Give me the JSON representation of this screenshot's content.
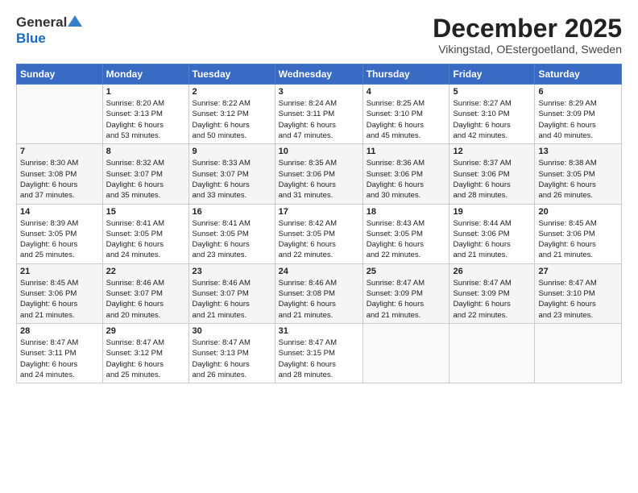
{
  "header": {
    "logo_general": "General",
    "logo_blue": "Blue",
    "month_title": "December 2025",
    "location": "Vikingstad, OEstergoetland, Sweden"
  },
  "columns": [
    "Sunday",
    "Monday",
    "Tuesday",
    "Wednesday",
    "Thursday",
    "Friday",
    "Saturday"
  ],
  "weeks": [
    [
      {
        "day": "",
        "info": ""
      },
      {
        "day": "1",
        "info": "Sunrise: 8:20 AM\nSunset: 3:13 PM\nDaylight: 6 hours\nand 53 minutes."
      },
      {
        "day": "2",
        "info": "Sunrise: 8:22 AM\nSunset: 3:12 PM\nDaylight: 6 hours\nand 50 minutes."
      },
      {
        "day": "3",
        "info": "Sunrise: 8:24 AM\nSunset: 3:11 PM\nDaylight: 6 hours\nand 47 minutes."
      },
      {
        "day": "4",
        "info": "Sunrise: 8:25 AM\nSunset: 3:10 PM\nDaylight: 6 hours\nand 45 minutes."
      },
      {
        "day": "5",
        "info": "Sunrise: 8:27 AM\nSunset: 3:10 PM\nDaylight: 6 hours\nand 42 minutes."
      },
      {
        "day": "6",
        "info": "Sunrise: 8:29 AM\nSunset: 3:09 PM\nDaylight: 6 hours\nand 40 minutes."
      }
    ],
    [
      {
        "day": "7",
        "info": "Sunrise: 8:30 AM\nSunset: 3:08 PM\nDaylight: 6 hours\nand 37 minutes."
      },
      {
        "day": "8",
        "info": "Sunrise: 8:32 AM\nSunset: 3:07 PM\nDaylight: 6 hours\nand 35 minutes."
      },
      {
        "day": "9",
        "info": "Sunrise: 8:33 AM\nSunset: 3:07 PM\nDaylight: 6 hours\nand 33 minutes."
      },
      {
        "day": "10",
        "info": "Sunrise: 8:35 AM\nSunset: 3:06 PM\nDaylight: 6 hours\nand 31 minutes."
      },
      {
        "day": "11",
        "info": "Sunrise: 8:36 AM\nSunset: 3:06 PM\nDaylight: 6 hours\nand 30 minutes."
      },
      {
        "day": "12",
        "info": "Sunrise: 8:37 AM\nSunset: 3:06 PM\nDaylight: 6 hours\nand 28 minutes."
      },
      {
        "day": "13",
        "info": "Sunrise: 8:38 AM\nSunset: 3:05 PM\nDaylight: 6 hours\nand 26 minutes."
      }
    ],
    [
      {
        "day": "14",
        "info": "Sunrise: 8:39 AM\nSunset: 3:05 PM\nDaylight: 6 hours\nand 25 minutes."
      },
      {
        "day": "15",
        "info": "Sunrise: 8:41 AM\nSunset: 3:05 PM\nDaylight: 6 hours\nand 24 minutes."
      },
      {
        "day": "16",
        "info": "Sunrise: 8:41 AM\nSunset: 3:05 PM\nDaylight: 6 hours\nand 23 minutes."
      },
      {
        "day": "17",
        "info": "Sunrise: 8:42 AM\nSunset: 3:05 PM\nDaylight: 6 hours\nand 22 minutes."
      },
      {
        "day": "18",
        "info": "Sunrise: 8:43 AM\nSunset: 3:05 PM\nDaylight: 6 hours\nand 22 minutes."
      },
      {
        "day": "19",
        "info": "Sunrise: 8:44 AM\nSunset: 3:06 PM\nDaylight: 6 hours\nand 21 minutes."
      },
      {
        "day": "20",
        "info": "Sunrise: 8:45 AM\nSunset: 3:06 PM\nDaylight: 6 hours\nand 21 minutes."
      }
    ],
    [
      {
        "day": "21",
        "info": "Sunrise: 8:45 AM\nSunset: 3:06 PM\nDaylight: 6 hours\nand 21 minutes."
      },
      {
        "day": "22",
        "info": "Sunrise: 8:46 AM\nSunset: 3:07 PM\nDaylight: 6 hours\nand 20 minutes."
      },
      {
        "day": "23",
        "info": "Sunrise: 8:46 AM\nSunset: 3:07 PM\nDaylight: 6 hours\nand 21 minutes."
      },
      {
        "day": "24",
        "info": "Sunrise: 8:46 AM\nSunset: 3:08 PM\nDaylight: 6 hours\nand 21 minutes."
      },
      {
        "day": "25",
        "info": "Sunrise: 8:47 AM\nSunset: 3:09 PM\nDaylight: 6 hours\nand 21 minutes."
      },
      {
        "day": "26",
        "info": "Sunrise: 8:47 AM\nSunset: 3:09 PM\nDaylight: 6 hours\nand 22 minutes."
      },
      {
        "day": "27",
        "info": "Sunrise: 8:47 AM\nSunset: 3:10 PM\nDaylight: 6 hours\nand 23 minutes."
      }
    ],
    [
      {
        "day": "28",
        "info": "Sunrise: 8:47 AM\nSunset: 3:11 PM\nDaylight: 6 hours\nand 24 minutes."
      },
      {
        "day": "29",
        "info": "Sunrise: 8:47 AM\nSunset: 3:12 PM\nDaylight: 6 hours\nand 25 minutes."
      },
      {
        "day": "30",
        "info": "Sunrise: 8:47 AM\nSunset: 3:13 PM\nDaylight: 6 hours\nand 26 minutes."
      },
      {
        "day": "31",
        "info": "Sunrise: 8:47 AM\nSunset: 3:15 PM\nDaylight: 6 hours\nand 28 minutes."
      },
      {
        "day": "",
        "info": ""
      },
      {
        "day": "",
        "info": ""
      },
      {
        "day": "",
        "info": ""
      }
    ]
  ]
}
